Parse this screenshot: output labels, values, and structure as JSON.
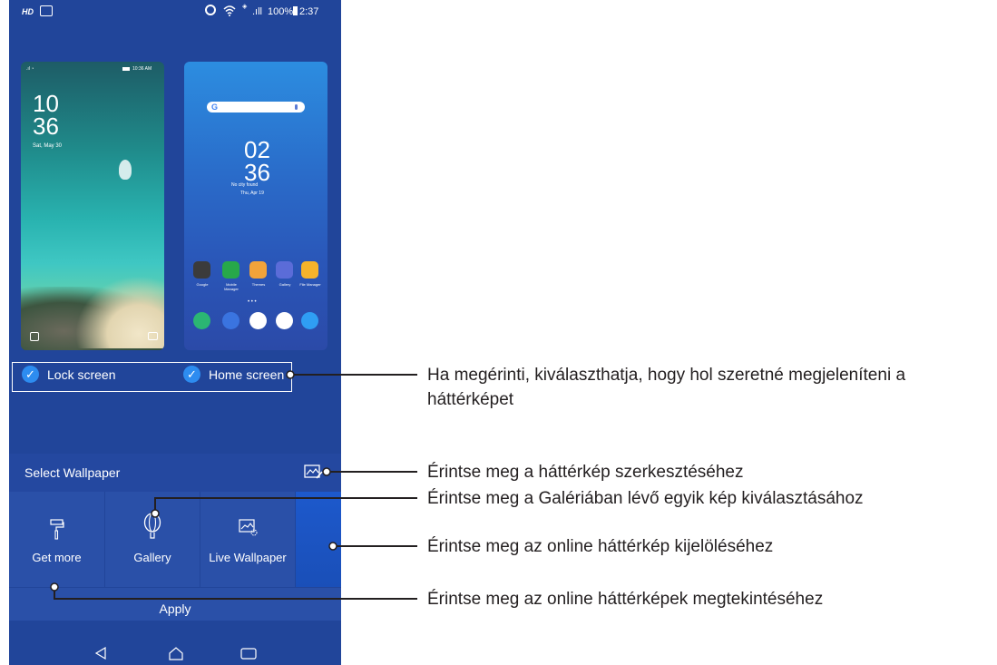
{
  "status_bar": {
    "left_text": "HD",
    "signal_text": ".ıll",
    "battery": "100%",
    "time": "2:37"
  },
  "lock_preview": {
    "status_time": "10:36 AM",
    "hour": "10",
    "minute": "36",
    "date": "Sat, May 30"
  },
  "home_preview": {
    "search_glyph": "G",
    "hour": "02",
    "minute": "36",
    "weather": "No city found",
    "date": "Thu, Apr 19",
    "apps": [
      {
        "label": "Google",
        "color": "#3b3b3b"
      },
      {
        "label": "Mobile Manager",
        "color": "#27a84a"
      },
      {
        "label": "Themes",
        "color": "#f2a33a"
      },
      {
        "label": "Gallery",
        "color": "#5b6cd8"
      },
      {
        "label": "File Manager",
        "color": "#f6b32b"
      }
    ],
    "dock": [
      "#2bb673",
      "#3a74e0",
      "#ffffff",
      "#ffffff",
      "#2f9ef4"
    ]
  },
  "targets": {
    "lock_label": "Lock screen",
    "home_label": "Home screen"
  },
  "select_wallpaper": {
    "label": "Select Wallpaper"
  },
  "tiles": [
    {
      "label": "Get more",
      "icon": "paint-roller-icon"
    },
    {
      "label": "Gallery",
      "icon": "balloon-icon"
    },
    {
      "label": "Live Wallpaper",
      "icon": "live-wallpaper-icon"
    }
  ],
  "apply": {
    "label": "Apply"
  },
  "callouts": {
    "targets": "Ha megérinti, kiválaszthatja, hogy hol szeretné megjeleníteni a háttérképet",
    "edit": "Érintse meg a háttérkép szerkesztéséhez",
    "gallery": "Érintse meg a Galériában lévő egyik kép kiválasztásához",
    "online": "Érintse meg az online háttérkép kijelöléséhez",
    "browse": "Érintse meg az online háttérképek megtekintéséhez"
  },
  "colors": {
    "phone_bg": "#21459a",
    "tile_bg": "#2a50a8",
    "selected_tile": "#1f55c8",
    "check": "#2d8cf0"
  }
}
